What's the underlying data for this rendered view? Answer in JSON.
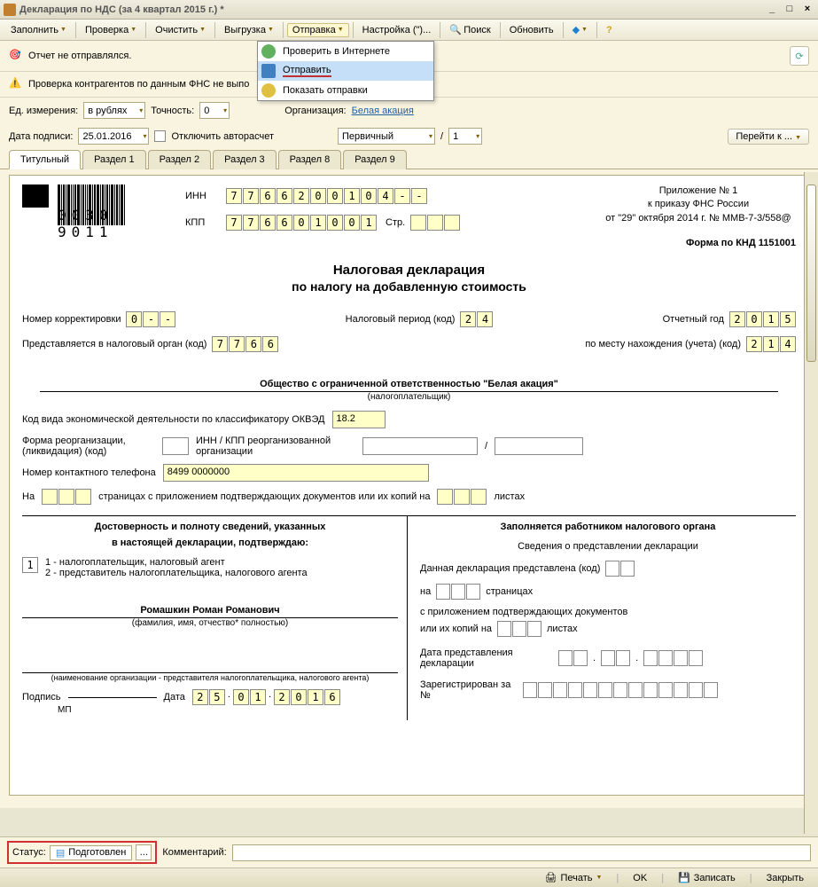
{
  "titlebar": {
    "text": "Декларация по НДС (за 4 квартал 2015 г.) *"
  },
  "toolbar": {
    "fill": "Заполнить",
    "check": "Проверка",
    "clear": "Очистить",
    "upload": "Выгрузка",
    "send": "Отправка",
    "settings": "Настройка (\")...",
    "search": "Поиск",
    "refresh": "Обновить"
  },
  "dropdown": {
    "check_internet": "Проверить в Интернете",
    "send": "Отправить",
    "show_sends": "Показать отправки"
  },
  "info1": "Отчет не отправлялся.",
  "info2": "Проверка контрагентов по данным ФНС не выпо",
  "controls": {
    "unit_label": "Ед. измерения:",
    "unit_value": "в рублях",
    "precision_label": "Точность:",
    "precision_value": "0",
    "org_label": "Организация:",
    "org_link": "Белая акация",
    "sign_date_label": "Дата подписи:",
    "sign_date": "25.01.2016",
    "autoreset": "Отключить авторасчет",
    "type_value": "Первичный",
    "slash_value": "1",
    "goto": "Перейти к ..."
  },
  "tabs": [
    "Титульный",
    "Раздел 1",
    "Раздел 2",
    "Раздел 3",
    "Раздел 8",
    "Раздел 9"
  ],
  "doc": {
    "barcode_num": "0030 9011",
    "inn_label": "ИНН",
    "inn": [
      "7",
      "7",
      "6",
      "6",
      "2",
      "0",
      "0",
      "1",
      "0",
      "4",
      "-",
      "-"
    ],
    "kpp_label": "КПП",
    "kpp": [
      "7",
      "7",
      "6",
      "6",
      "0",
      "1",
      "0",
      "0",
      "1"
    ],
    "page_label": "Стр.",
    "app": {
      "line1": "Приложение № 1",
      "line2": "к приказу ФНС России",
      "line3": "от \"29\" октября 2014 г. № ММВ-7-3/558@"
    },
    "form_code": "Форма по КНД 1151001",
    "title": "Налоговая декларация",
    "subtitle": "по налогу на добавленную стоимость",
    "corr_label": "Номер корректировки",
    "corr": [
      "0",
      "-",
      "-"
    ],
    "period_label": "Налоговый период  (код)",
    "period": [
      "2",
      "4"
    ],
    "year_label": "Отчетный год",
    "year": [
      "2",
      "0",
      "1",
      "5"
    ],
    "tax_auth_label": "Представляется в налоговый орган   (код)",
    "tax_auth": [
      "7",
      "7",
      "6",
      "6"
    ],
    "loc_label": "по месту нахождения (учета) (код)",
    "loc": [
      "2",
      "1",
      "4"
    ],
    "org_name": "Общество с ограниченной ответственностью \"Белая акация\"",
    "org_sub": "(налогоплательщик)",
    "okved_label": "Код вида экономической деятельности по классификатору ОКВЭД",
    "okved": "18.2",
    "reorg_label": "Форма реорганизации, (ликвидация) (код)",
    "reorg_inn_label": "ИНН / КПП реорганизованной организации",
    "phone_label": "Номер контактного телефона",
    "phone": "8499 0000000",
    "pages_pre": "На",
    "pages_mid": "страницах с приложением подтверждающих документов или их копий на",
    "pages_post": "листах",
    "left_col": {
      "title1": "Достоверность и полноту сведений, указанных",
      "title2": "в настоящей декларации, подтверждаю:",
      "code": "1",
      "opt1": "1 - налогоплательщик, налоговый агент",
      "opt2": "2 - представитель налогоплательщика, налогового агента",
      "name": "Ромашкин Роман Романович",
      "name_sub": "(фамилия, имя, отчество* полностью)",
      "rep_sub": "(наименование организации - представителя налогоплательщика, налогового агента)",
      "sign_label": "Подпись",
      "mp": "МП",
      "date_label": "Дата",
      "date": [
        "2",
        "5",
        "0",
        "1",
        "2",
        "0",
        "1",
        "6"
      ]
    },
    "right_col": {
      "title": "Заполняется работником налогового органа",
      "sub": "Сведения о представлении декларации",
      "present_label": "Данная декларация представлена   (код)",
      "on": "на",
      "pages": "страницах",
      "attach": "с приложением подтверждающих документов",
      "copies": "или их копий на",
      "sheets": "листах",
      "date_label": "Дата представления декларации",
      "reg_label": "Зарегистрирован за №"
    }
  },
  "status": {
    "label": "Статус:",
    "value": "Подготовлен",
    "comment_label": "Комментарий:"
  },
  "bottom": {
    "print": "Печать",
    "ok": "OK",
    "save": "Записать",
    "close": "Закрыть"
  }
}
